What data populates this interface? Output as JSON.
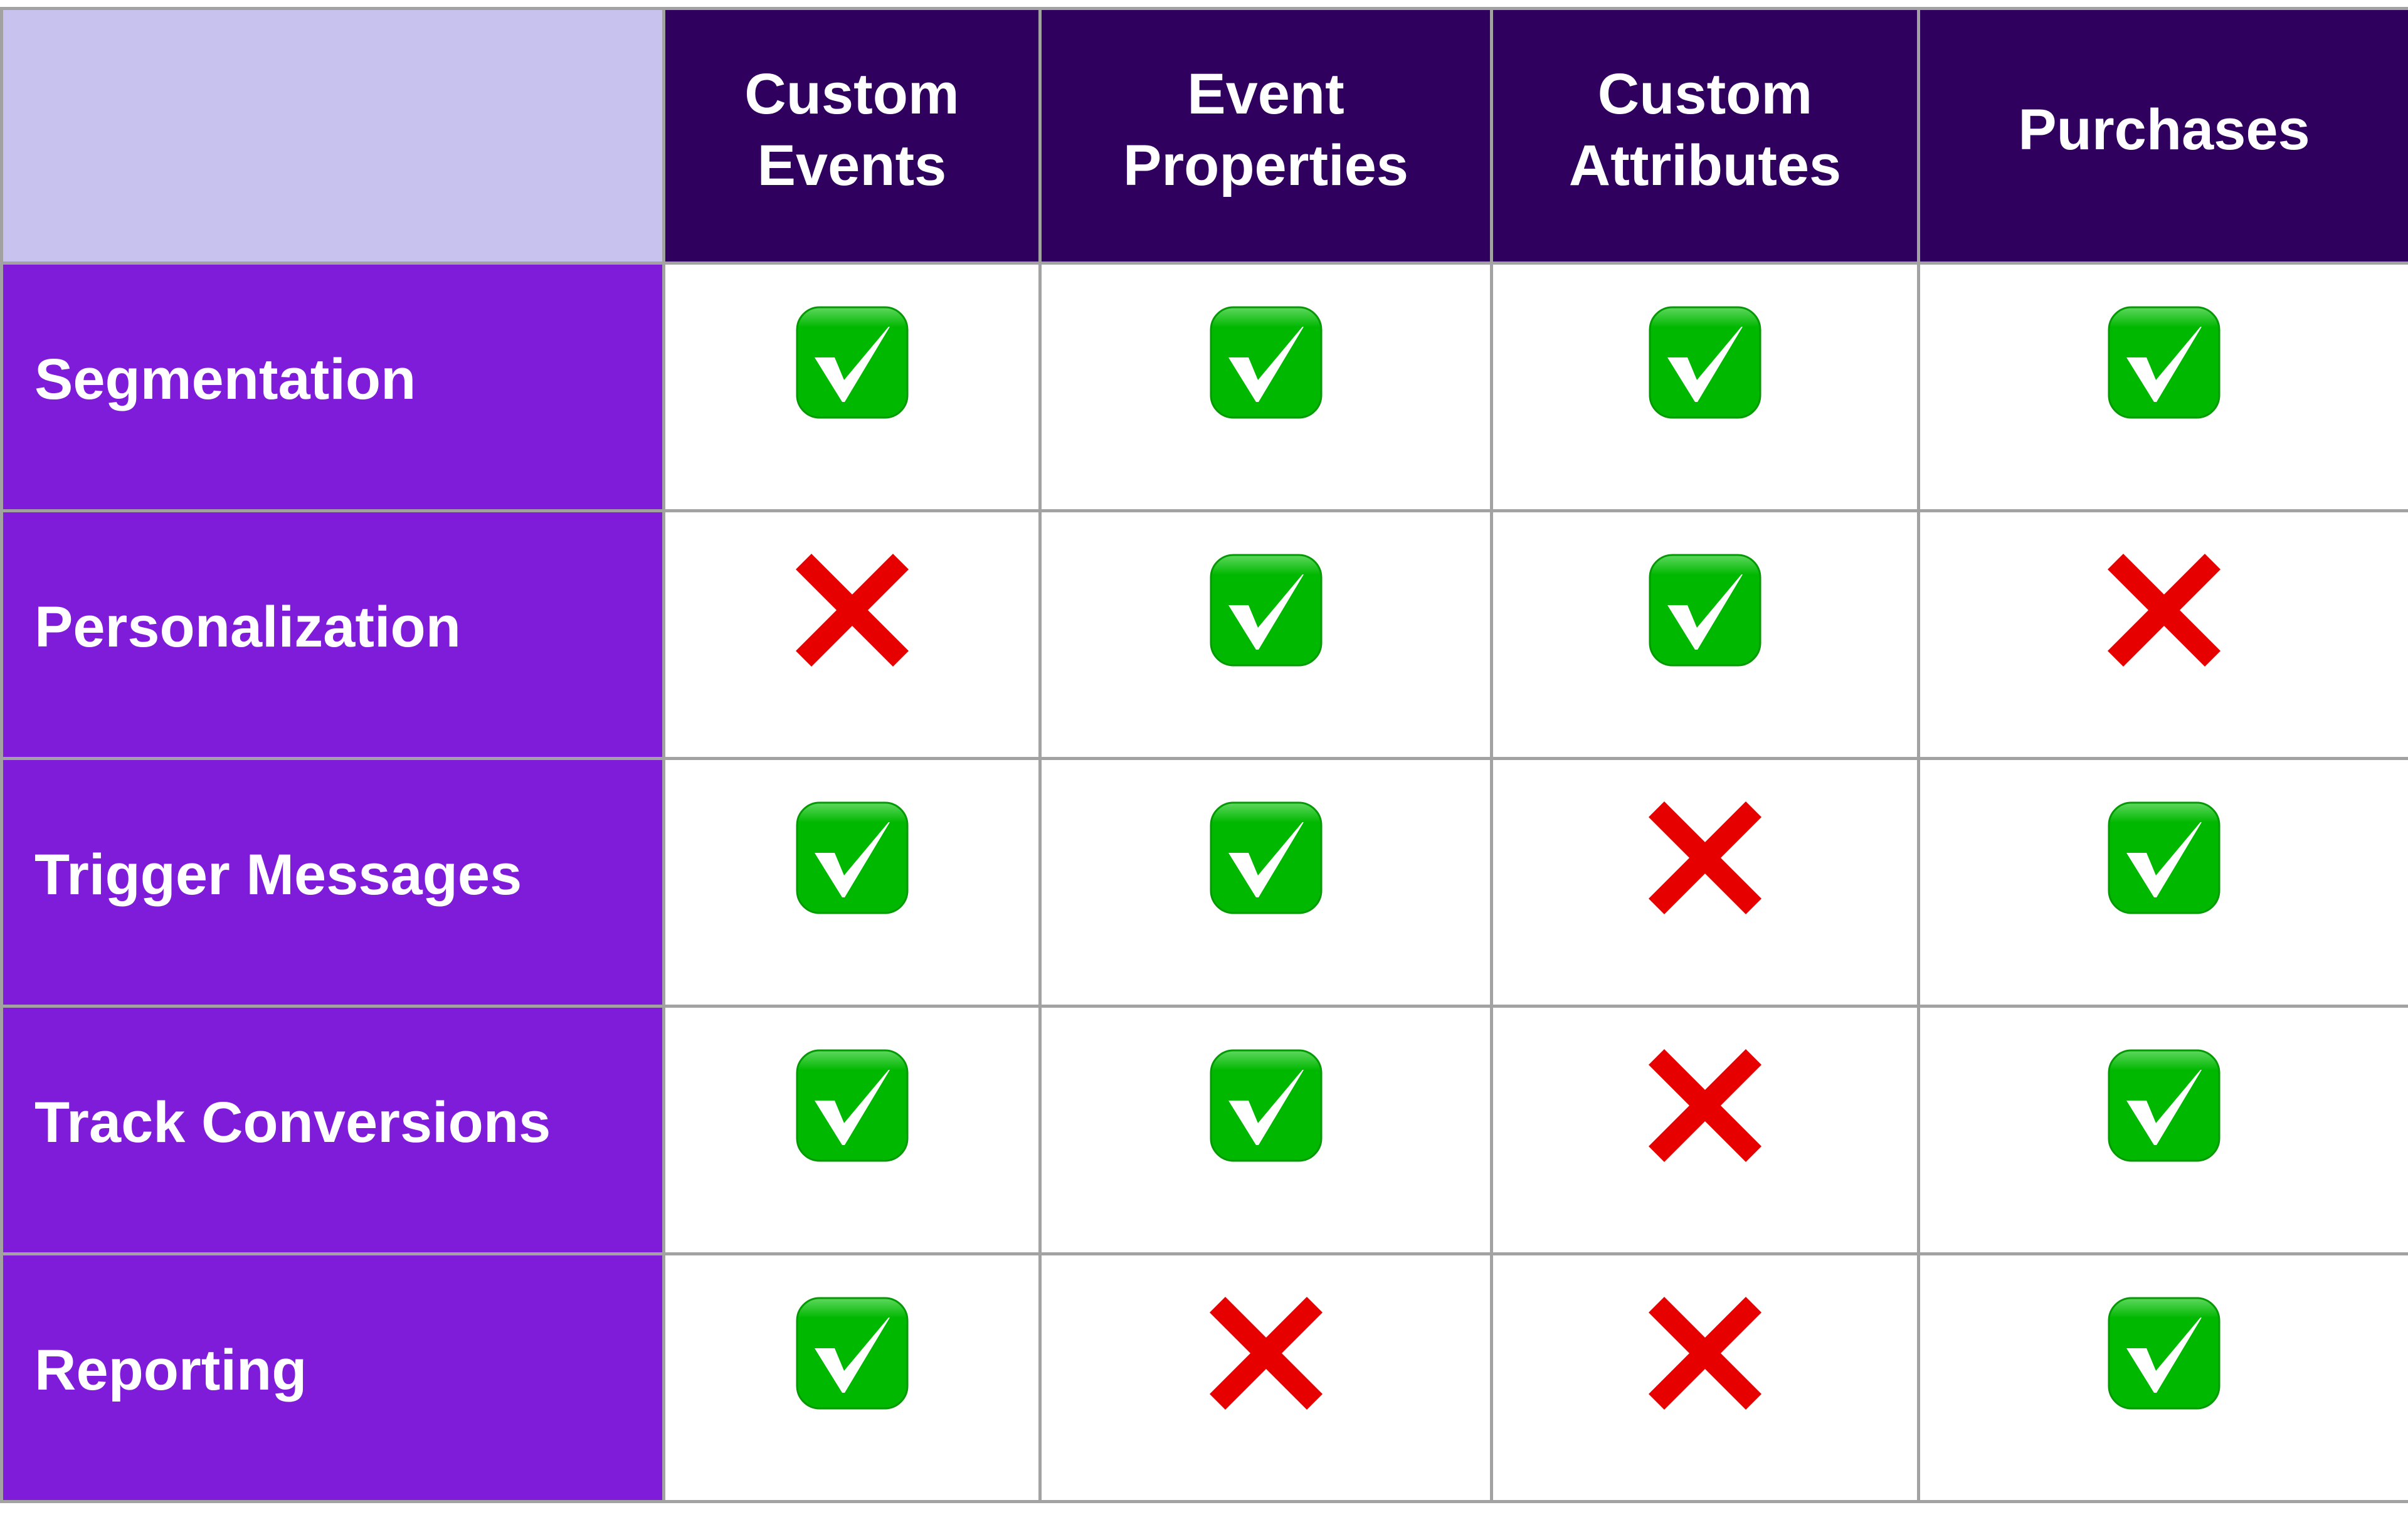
{
  "colors": {
    "corner_bg": "#c8c3ee",
    "column_header_bg": "#30005e",
    "row_header_bg": "#7e1cd9",
    "grid_line": "#a2a2a2",
    "check_green": "#00b800",
    "cross_red": "#e60000"
  },
  "table": {
    "corner_label": "",
    "columns": [
      {
        "label": "Custom\nEvents"
      },
      {
        "label": "Event\nProperties"
      },
      {
        "label": "Custom\nAttributes"
      },
      {
        "label": "Purchases"
      }
    ],
    "rows": [
      {
        "label": "Segmentation",
        "cells": [
          "check-icon",
          "check-icon",
          "check-icon",
          "check-icon"
        ],
        "values": [
          true,
          true,
          true,
          true
        ]
      },
      {
        "label": "Personalization",
        "cells": [
          "cross-icon",
          "check-icon",
          "check-icon",
          "cross-icon"
        ],
        "values": [
          false,
          true,
          true,
          false
        ]
      },
      {
        "label": "Trigger Messages",
        "cells": [
          "check-icon",
          "check-icon",
          "cross-icon",
          "check-icon"
        ],
        "values": [
          true,
          true,
          false,
          true
        ]
      },
      {
        "label": "Track Conversions",
        "cells": [
          "check-icon",
          "check-icon",
          "cross-icon",
          "check-icon"
        ],
        "values": [
          true,
          true,
          false,
          true
        ]
      },
      {
        "label": "Reporting",
        "cells": [
          "check-icon",
          "cross-icon",
          "cross-icon",
          "check-icon"
        ],
        "values": [
          true,
          false,
          false,
          true
        ]
      }
    ]
  }
}
